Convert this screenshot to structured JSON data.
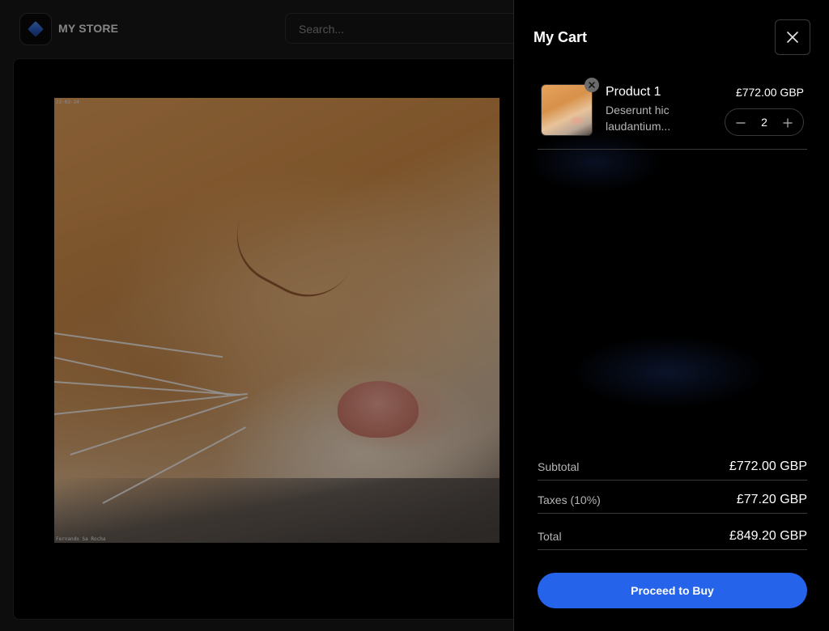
{
  "store": {
    "name": "MY STORE",
    "search_placeholder": "Search..."
  },
  "hero_photo": {
    "stamp_top": "22-02-24",
    "stamp_bottom": "Fernando Sa Rocha"
  },
  "cart": {
    "title": "My Cart",
    "items": [
      {
        "name": "Product 1",
        "description": "Deserunt hic laudantium...",
        "price": "£772.00 GBP",
        "quantity": "2"
      }
    ],
    "summary": {
      "subtotal_label": "Subtotal",
      "subtotal_value": "£772.00 GBP",
      "taxes_label": "Taxes (10%)",
      "taxes_value": "£77.20 GBP",
      "total_label": "Total",
      "total_value": "£849.20 GBP"
    },
    "buy_label": "Proceed to Buy"
  },
  "colors": {
    "accent": "#2563eb",
    "drawer_bg": "#000000",
    "page_bg": "#171717"
  },
  "icons": {
    "logo": "diamond-logo-icon",
    "close": "close-icon",
    "remove": "remove-item-icon",
    "minus": "minus-icon",
    "plus": "plus-icon"
  }
}
